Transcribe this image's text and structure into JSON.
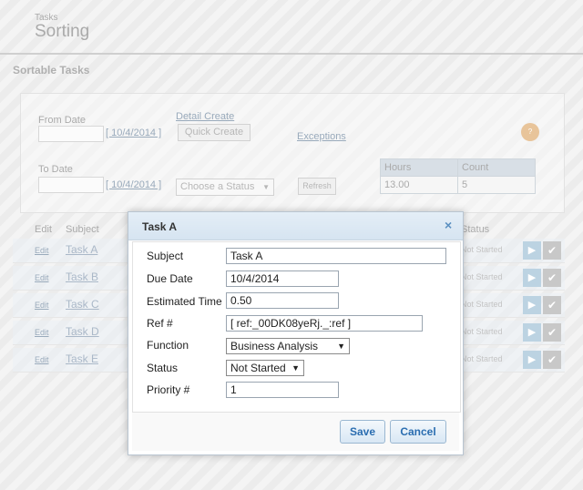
{
  "header": {
    "breadcrumb": "Tasks",
    "title": "Sorting"
  },
  "section": {
    "title": "Sortable Tasks"
  },
  "filters": {
    "from_label": "From Date",
    "from_date_link": "[ 10/4/2014 ]",
    "to_label": "To Date",
    "to_date_link": "[ 10/4/2014 ]",
    "detail_create_link": "Detail Create",
    "quick_create_button": "Quick Create",
    "exceptions_link": "Exceptions",
    "status_select": "Choose a Status",
    "refresh_button": "Refresh",
    "help_icon_text": "?"
  },
  "stats": {
    "headers": [
      "Hours",
      "Count"
    ],
    "values": [
      "13.00",
      "5"
    ]
  },
  "table": {
    "columns": {
      "edit": "Edit",
      "subject": "Subject",
      "status": "Status"
    },
    "rows": [
      {
        "edit": "Edit",
        "subject": "Task A",
        "status": "Not Started"
      },
      {
        "edit": "Edit",
        "subject": "Task B",
        "status": "Not Started"
      },
      {
        "edit": "Edit",
        "subject": "Task C",
        "status": "Not Started"
      },
      {
        "edit": "Edit",
        "subject": "Task D",
        "status": "Not Started"
      },
      {
        "edit": "Edit",
        "subject": "Task E",
        "status": "Not Started"
      }
    ]
  },
  "modal": {
    "title": "Task A",
    "close_glyph": "×",
    "fields": {
      "subject": {
        "label": "Subject",
        "value": "Task A"
      },
      "due_date": {
        "label": "Due Date",
        "value": "10/4/2014"
      },
      "estimated_time": {
        "label": "Estimated Time",
        "value": "0.50"
      },
      "ref": {
        "label": "Ref #",
        "value": "[ ref:_00DK08yeRj._:ref ]"
      },
      "function": {
        "label": "Function",
        "value": "Business Analysis"
      },
      "status": {
        "label": "Status",
        "value": "Not Started"
      },
      "priority": {
        "label": "Priority #",
        "value": "1"
      }
    },
    "save_label": "Save",
    "cancel_label": "Cancel"
  },
  "icons": {
    "play": "play-icon",
    "check": "check-icon",
    "close": "close-icon",
    "help": "help-icon"
  },
  "colors": {
    "accent": "#2a6db0",
    "modal_header": "#d6e4f1"
  }
}
